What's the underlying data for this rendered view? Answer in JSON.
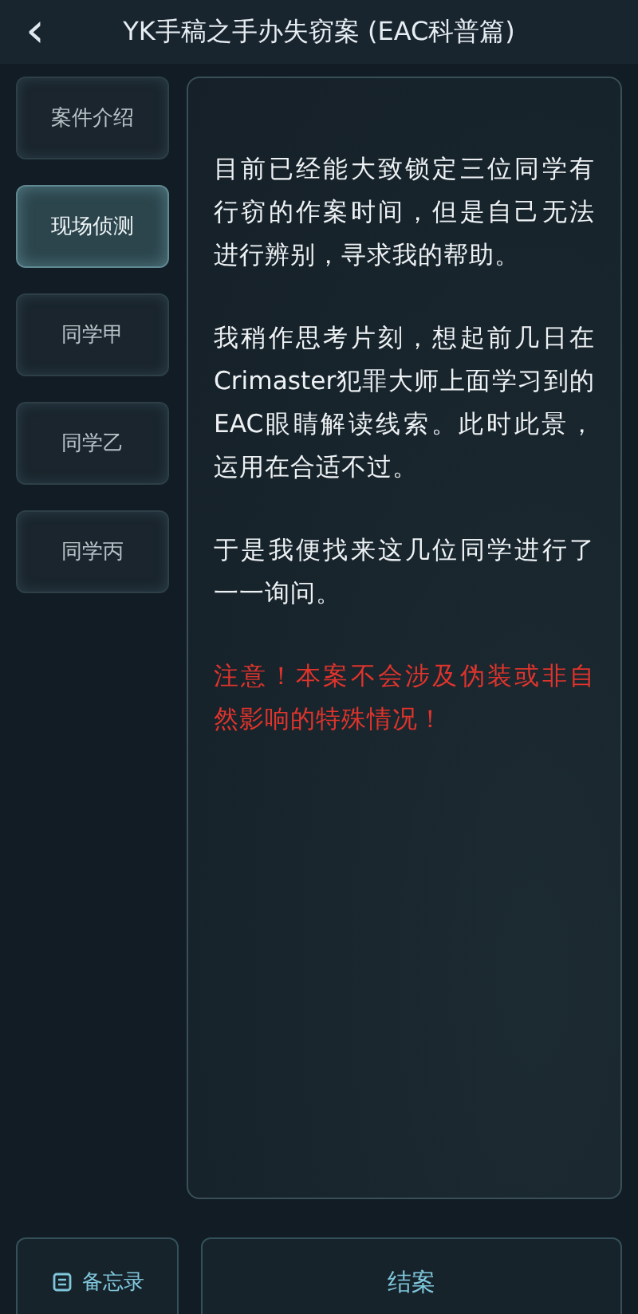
{
  "header": {
    "back_icon": "‹",
    "title": "YK手稿之手办失窃案 (EAC科普篇)"
  },
  "sidebar": {
    "items": [
      {
        "label": "案件介绍",
        "selected": false
      },
      {
        "label": "现场侦测",
        "selected": true
      },
      {
        "label": "同学甲",
        "selected": false
      },
      {
        "label": "同学乙",
        "selected": false
      },
      {
        "label": "同学丙",
        "selected": false
      }
    ]
  },
  "paragraphs": [
    {
      "kind": "normal",
      "text": "目前已经能大致锁定三位同学有行窃的作案时间，但是自己无法进行辨别，寻求我的帮助。"
    },
    {
      "kind": "normal",
      "text": "我稍作思考片刻，想起前几日在Crimaster犯罪大师上面学习到的EAC眼睛解读线索。此时此景，运用在合适不过。"
    },
    {
      "kind": "normal",
      "text": "于是我便找来这几位同学进行了一一询问。"
    },
    {
      "kind": "warning",
      "text": "注意！本案不会涉及伪装或非自然影响的特殊情况！"
    }
  ],
  "footer": {
    "memo_button": "备忘录",
    "close_case_button": "结案"
  }
}
